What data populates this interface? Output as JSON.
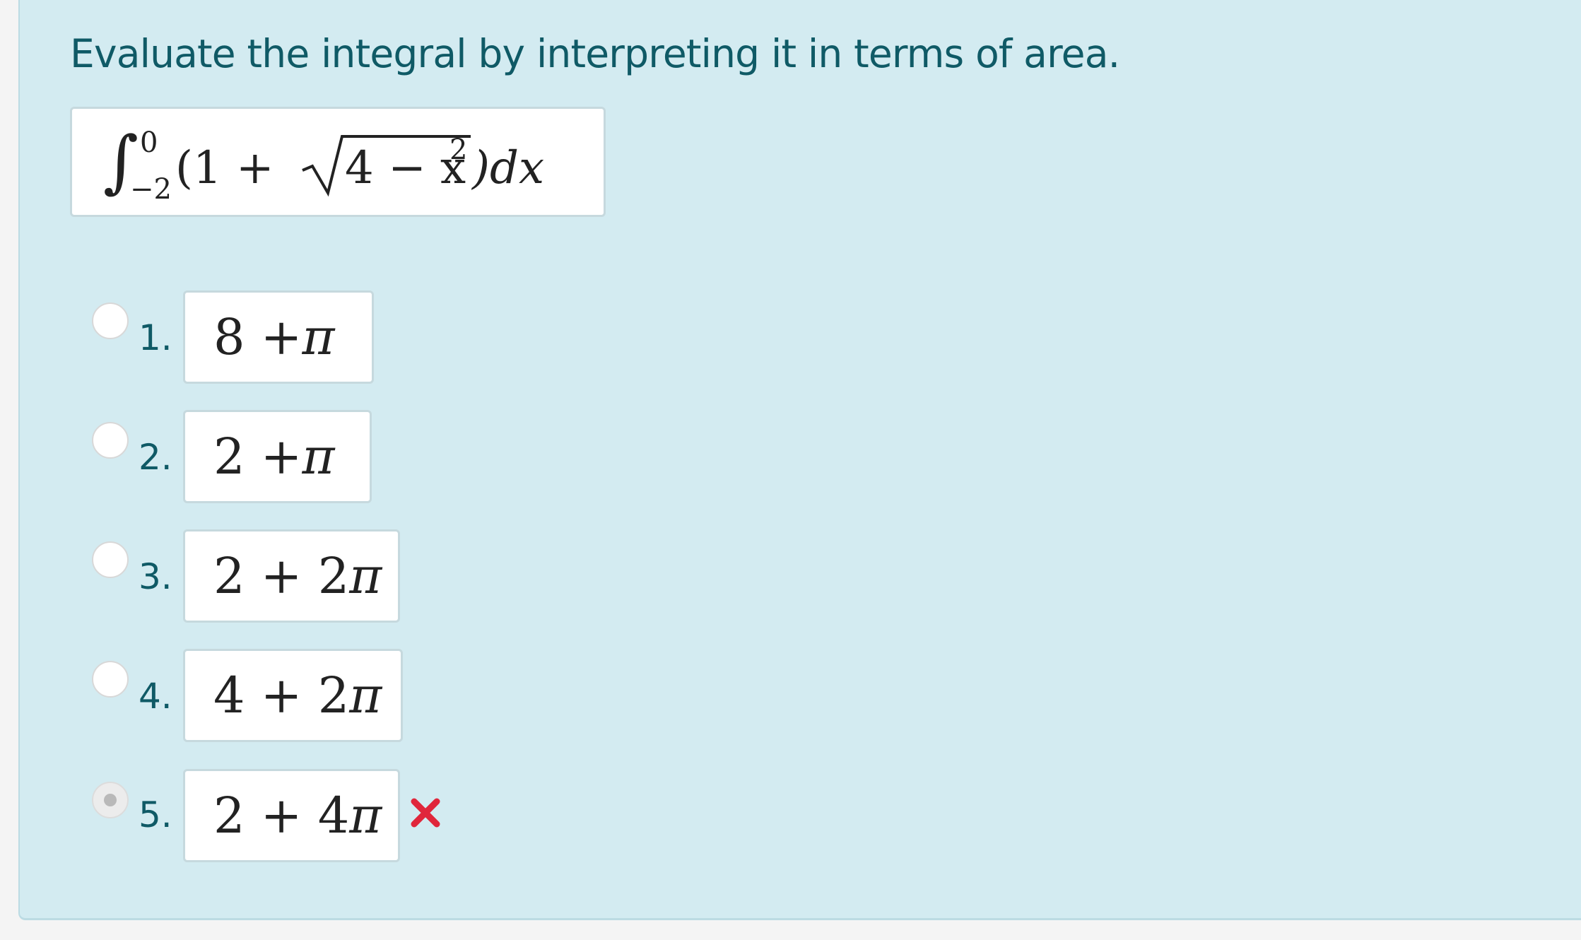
{
  "question": {
    "prompt": "Evaluate the integral by interpreting it in terms of area.",
    "expression": {
      "integral_sign": "∫",
      "upper_limit": "0",
      "lower_limit": "−2",
      "open_paren": "(1 +",
      "radicand": "4 − x",
      "exponent": "2",
      "close": ")dx"
    }
  },
  "options": [
    {
      "number": "1.",
      "lead": "8 + ",
      "pi": "π",
      "selected": false
    },
    {
      "number": "2.",
      "lead": "2 + ",
      "pi": "π",
      "selected": false
    },
    {
      "number": "3.",
      "lead": "2 + 2",
      "pi": "π",
      "selected": false
    },
    {
      "number": "4.",
      "lead": "4 + 2",
      "pi": "π",
      "selected": false
    },
    {
      "number": "5.",
      "lead": "2 + 4",
      "pi": "π",
      "selected": true
    }
  ],
  "feedback": {
    "icon": "incorrect-x-icon",
    "color": "#e0263b"
  },
  "colors": {
    "panel": "#d3ebf1",
    "text": "#0f5a66"
  }
}
